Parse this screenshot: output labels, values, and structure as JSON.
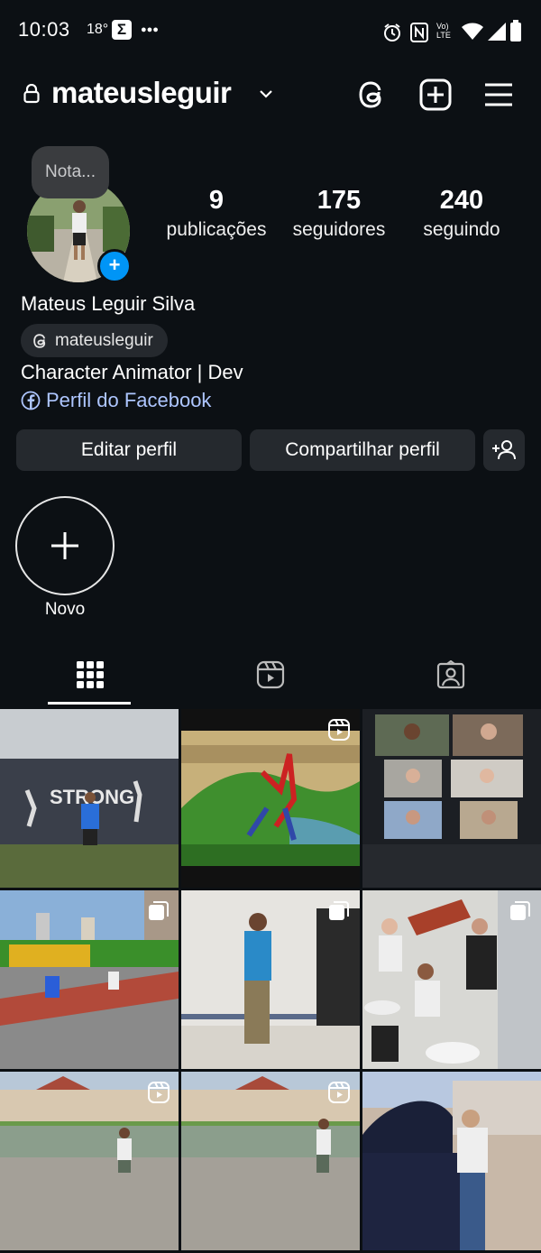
{
  "status_bar": {
    "time": "10:03",
    "temperature": "18°",
    "volte_label": "Vo) LTE"
  },
  "header": {
    "username": "mateusleguir"
  },
  "profile": {
    "note_bubble": "Nota...",
    "stats": [
      {
        "value": "9",
        "label": "publicações"
      },
      {
        "value": "175",
        "label": "seguidores"
      },
      {
        "value": "240",
        "label": "seguindo"
      }
    ],
    "full_name": "Mateus Leguir Silva",
    "threads_handle": "mateusleguir",
    "bio": "Character Animator | Dev",
    "facebook_link": "Perfil do Facebook"
  },
  "buttons": {
    "edit_profile": "Editar perfil",
    "share_profile": "Compartilhar perfil"
  },
  "highlights": {
    "new_label": "Novo"
  },
  "grid": {
    "posts": [
      {
        "badge": "none"
      },
      {
        "badge": "reel"
      },
      {
        "badge": "none"
      },
      {
        "badge": "carousel"
      },
      {
        "badge": "carousel"
      },
      {
        "badge": "carousel"
      },
      {
        "badge": "reel"
      },
      {
        "badge": "reel"
      },
      {
        "badge": "none"
      }
    ]
  },
  "colors": {
    "background": "#0c1014",
    "button": "#25292e",
    "accent_blue": "#0095f6",
    "link": "#aec6ff"
  }
}
